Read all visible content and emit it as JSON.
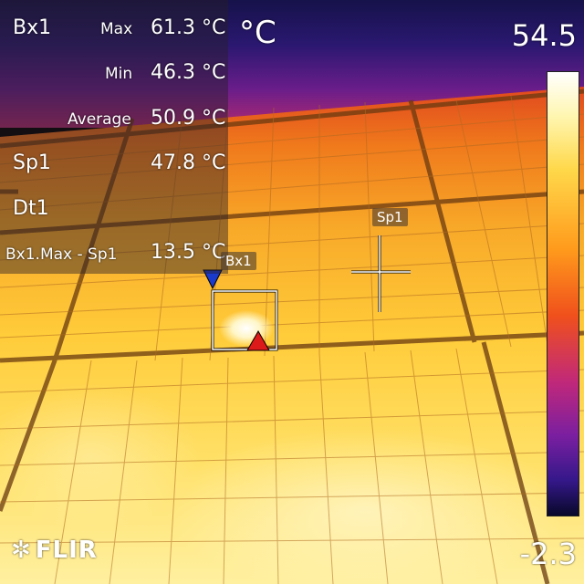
{
  "measurements": {
    "bx1_label": "Bx1",
    "max_label": "Max",
    "max_value": "61.3 °C",
    "min_label": "Min",
    "min_value": "46.3 °C",
    "avg_label": "Average",
    "avg_value": "50.9 °C",
    "sp1_label": "Sp1",
    "sp1_value": "47.8 °C",
    "dt1_label": "Dt1",
    "diff_label": "Bx1.Max - Sp1",
    "diff_value": "13.5 °C"
  },
  "unit_label": "°C",
  "scale": {
    "max_label": "54.5",
    "min_label": "-2.3"
  },
  "markers": {
    "sp1_tag": "Sp1",
    "bx1_tag": "Bx1"
  },
  "brand": {
    "logo_text": "FLIR"
  },
  "colors": {
    "hot": "#ffffff",
    "warm": "#ffd84a",
    "mid": "#f07a1c",
    "cool": "#7a1fa0",
    "cold": "#08082a"
  }
}
